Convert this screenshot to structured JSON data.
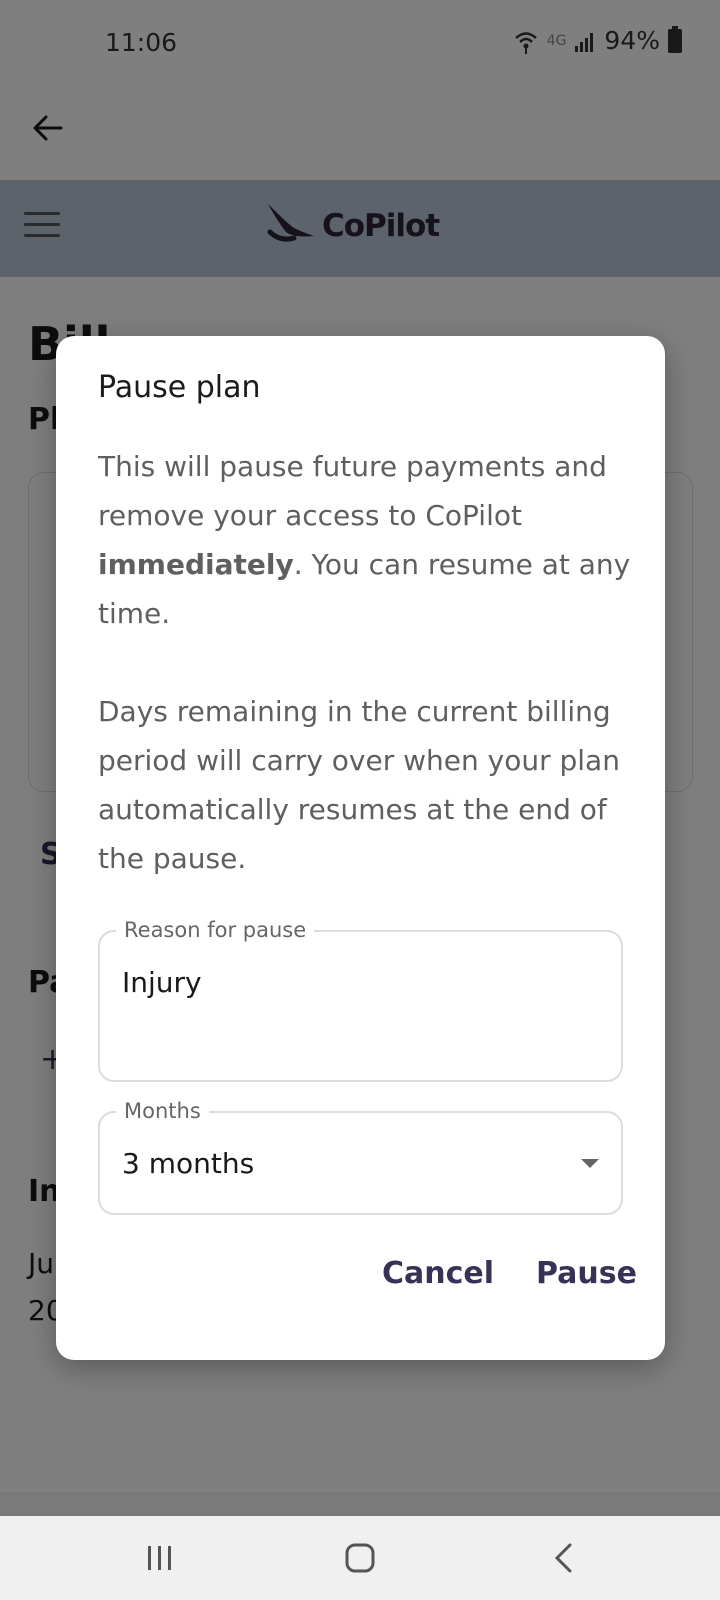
{
  "status_bar": {
    "time": "11:06",
    "network": "4G",
    "battery": "94%"
  },
  "header": {
    "brand": "CoPilot"
  },
  "background_page": {
    "title_partial": "Bill",
    "section1_partial": "Pl",
    "link_partial": "S",
    "section2_partial": "Pa",
    "add_partial": "+",
    "section3_partial": "In",
    "line1_partial": "Ju",
    "line2_partial": "20"
  },
  "dialog": {
    "title": "Pause plan",
    "body_part1": "This will pause future payments and remove your access to CoPilot ",
    "body_bold": "immediately",
    "body_part2": ". You can resume at any time.",
    "body_para2": "Days remaining in the current billing period will carry over when your plan automatically resumes at the end of the pause.",
    "reason_label": "Reason for pause",
    "reason_value": "Injury",
    "months_label": "Months",
    "months_value": "3 months",
    "cancel_label": "Cancel",
    "pause_label": "Pause"
  },
  "colors": {
    "accent": "#3a3156",
    "header_band": "#bac6d6"
  }
}
